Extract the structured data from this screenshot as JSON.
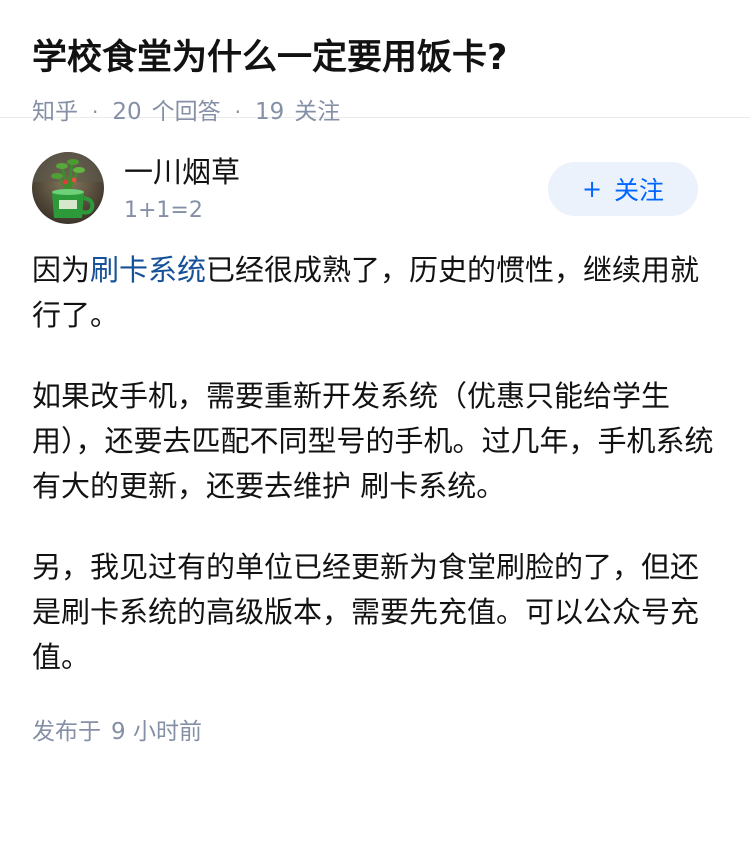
{
  "question": {
    "title": "学校食堂为什么一定要用饭卡?",
    "source": "知乎",
    "answers_count": "20",
    "answers_label": "个回答",
    "followers_count": "19",
    "followers_label": "关注"
  },
  "answer": {
    "author": {
      "name": "一川烟草",
      "bio": "1+1=2"
    },
    "follow_button": {
      "plus": "+",
      "label": "关注"
    },
    "paragraphs": {
      "p1_pre": "因为",
      "p1_link": "刷卡系统",
      "p1_post": "已经很成熟了，历史的惯性，继续用就行了。",
      "p2": "如果改手机，需要重新开发系统（优惠只能给学生用），还要去匹配不同型号的手机。过几年，手机系统有大的更新，还要去维护 刷卡系统。",
      "p3": "另，我见过有的单位已经更新为食堂刷脸的了，但还是刷卡系统的高级版本，需要先充值。可以公众号充值。"
    },
    "publish": {
      "label": "发布于",
      "time": "9 小时前"
    }
  },
  "colors": {
    "link": "#175199",
    "meta": "#8590a6",
    "follow_text": "#0066ff",
    "follow_bg": "#ebf2fb"
  },
  "icons": {
    "avatar": "avatar-plant-in-green-mug"
  }
}
